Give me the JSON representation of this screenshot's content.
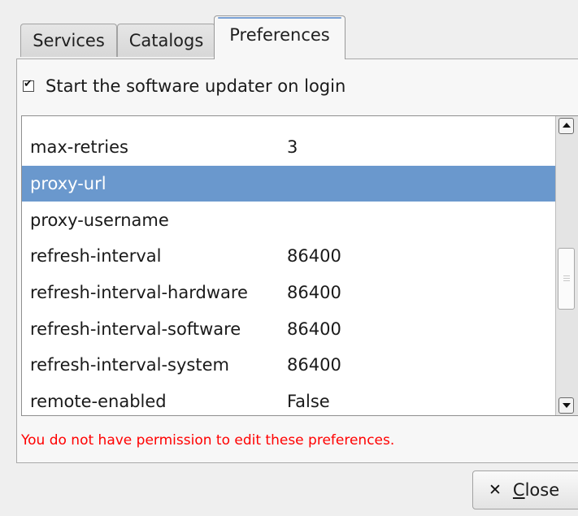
{
  "tabs": [
    {
      "label": "Services"
    },
    {
      "label": "Catalogs"
    },
    {
      "label": "Preferences",
      "active": true
    }
  ],
  "startup_checkbox": {
    "label": "Start the software updater on login",
    "checked": true
  },
  "preferences": [
    {
      "key": "max-retries",
      "value": "3"
    },
    {
      "key": "proxy-url",
      "value": "",
      "selected": true
    },
    {
      "key": "proxy-username",
      "value": ""
    },
    {
      "key": "refresh-interval",
      "value": "86400"
    },
    {
      "key": "refresh-interval-hardware",
      "value": "86400"
    },
    {
      "key": "refresh-interval-software",
      "value": "86400"
    },
    {
      "key": "refresh-interval-system",
      "value": "86400"
    },
    {
      "key": "remote-enabled",
      "value": "False"
    }
  ],
  "error_message": "You do not have permission to edit these preferences.",
  "close_button": {
    "mnemonic": "C",
    "rest": "lose"
  },
  "colors": {
    "selection": "#6a98cd",
    "error": "#ff0000"
  }
}
